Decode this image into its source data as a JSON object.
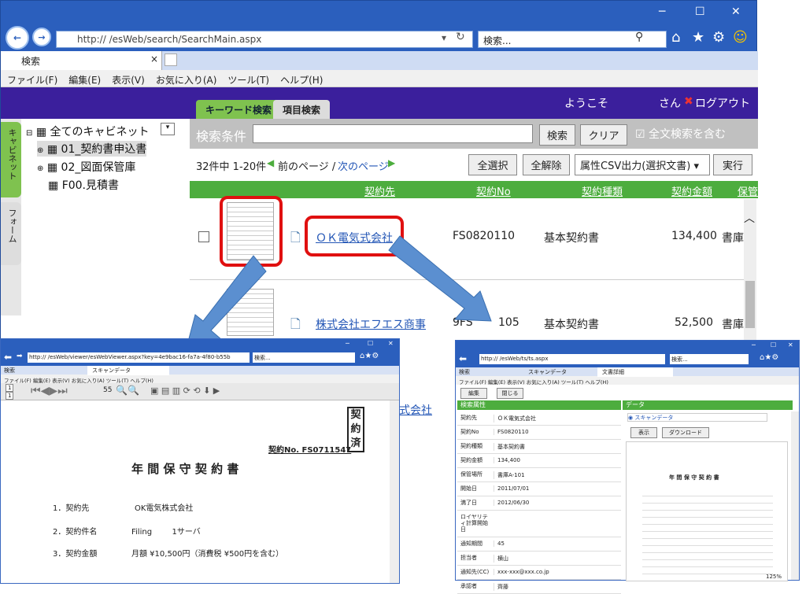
{
  "browser": {
    "url": "http://                         /esWeb/search/SearchMain.aspx",
    "search_placeholder": "検索...",
    "tab_title": "検索",
    "menu": [
      "ファイル(F)",
      "編集(E)",
      "表示(V)",
      "お気に入り(A)",
      "ツール(T)",
      "ヘルプ(H)"
    ]
  },
  "app": {
    "tabs": [
      "キーワード検索",
      "項目検索"
    ],
    "welcome": "ようこそ",
    "user_suffix": "さん",
    "logout": "ログアウト",
    "side_tabs": [
      "キャビネット",
      "フォーム"
    ],
    "tree": [
      "全てのキャビネット",
      "01_契約書申込書",
      "02_図面保管庫",
      "F00.見積書"
    ]
  },
  "search": {
    "label": "検索条件",
    "search_btn": "検索",
    "clear_btn": "クリア",
    "fulltext": "全文検索を含む",
    "paging": "32件中 1-20件",
    "prev": "前のページ /",
    "next": "次のページ",
    "select_all": "全選択",
    "deselect_all": "全解除",
    "csv": "属性CSV出力(選択文書)",
    "run": "実行"
  },
  "table": {
    "headers": [
      "契約先",
      "契約No",
      "契約種類",
      "契約金額",
      "保管"
    ],
    "rows": [
      {
        "party": "ＯＫ電気式会社",
        "no": "FS0820110",
        "type": "基本契約書",
        "amount": "134,400",
        "loc": "書庫"
      },
      {
        "party": "株式会社エフエス商事",
        "no": "9FS",
        "no2": "105",
        "type": "基本契約書",
        "amount": "52,500",
        "loc": "書庫"
      },
      {
        "party": "式会社"
      }
    ]
  },
  "viewer": {
    "url": "http://         /esWeb/viewer/esWebViewer.aspx?key=4e9bac16-fa7a-4f80-b55b",
    "search": "検索...",
    "tabs": [
      "検索",
      "スキャンデータ"
    ],
    "menu": "ファイル(F)  編集(E)  表示(V)  お気に入り(A)  ツール(T)  ヘルプ(H)",
    "page_top": "1",
    "page_bot": "1",
    "zoom": "55",
    "doc": {
      "stamp": [
        "契",
        "約",
        "済"
      ],
      "contract_no": "契約No. FS0711547",
      "title": "年 間 保 守 契 約 書",
      "items": [
        {
          "n": "1．契約先",
          "v": "OK電気株式会社"
        },
        {
          "n": "2．契約件名",
          "v": "Filing        1サーバ"
        },
        {
          "n": "3．契約金額",
          "v": "月額  ¥10,500円（消費税  ¥500円を含む）"
        }
      ]
    }
  },
  "detail": {
    "url": "http://         /esWeb/ts/ts.aspx",
    "search": "検索...",
    "tabs": [
      "検索",
      "スキャンデータ",
      "文書詳細"
    ],
    "menu": "ファイル(F)  編集(E)  表示(V)  お気に入り(A)  ツール(T)  ヘルプ(H)",
    "edit": "編集",
    "close": "閉じる",
    "attr_title": "検索属性",
    "data_title": "データ",
    "scan_link": "スキャンデータ",
    "show": "表示",
    "download": "ダウンロード",
    "attrs": [
      [
        "契約先",
        "ＯＫ電気式会社"
      ],
      [
        "契約No",
        "FS0820110"
      ],
      [
        "契約種類",
        "基本契約書"
      ],
      [
        "契約金額",
        "134,400"
      ],
      [
        "保管場所",
        "書庫A-101"
      ],
      [
        "開始日",
        "2011/07/01"
      ],
      [
        "満了日",
        "2012/06/30"
      ],
      [
        "ロイヤリティ計算開始日",
        ""
      ],
      [
        "通知期間",
        "45"
      ],
      [
        "担当者",
        "横山"
      ],
      [
        "通知先(CC)",
        "xxx-xxx@xxx.co.jp"
      ],
      [
        "承認者",
        "齊藤"
      ]
    ],
    "mini_title": "年 間 保 守 契 約 書",
    "zoom": "125%"
  }
}
